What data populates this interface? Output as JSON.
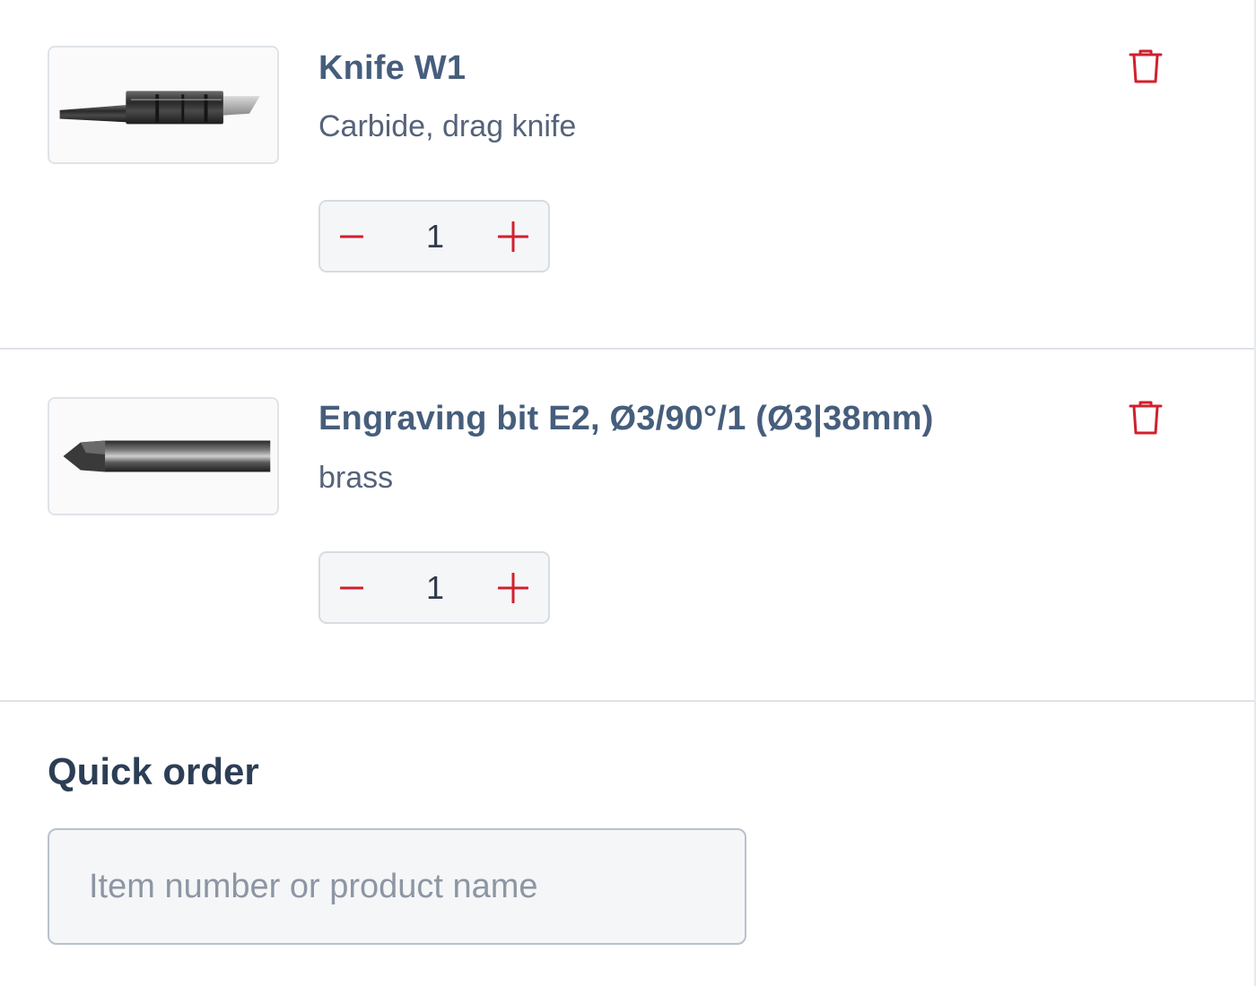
{
  "cart": {
    "items": [
      {
        "title": "Knife W1",
        "subtitle": "Carbide, drag knife",
        "quantity": "1",
        "image_icon": "drag-knife-blade-image"
      },
      {
        "title": "Engraving bit E2, Ø3/90°/1 (Ø3|38mm)",
        "subtitle": "brass",
        "quantity": "1",
        "image_icon": "engraving-bit-image"
      }
    ],
    "controls": {
      "decrease_icon": "minus-icon",
      "increase_icon": "plus-icon",
      "remove_icon": "trash-icon"
    }
  },
  "quick_order": {
    "title": "Quick order",
    "input_value": "",
    "input_placeholder": "Item number or product name"
  },
  "colors": {
    "accent_red": "#d0202e",
    "title_blue": "#465e7c",
    "heading_dark": "#2c3e55",
    "border": "#dfe3e8",
    "field_bg": "#f5f6f8"
  }
}
